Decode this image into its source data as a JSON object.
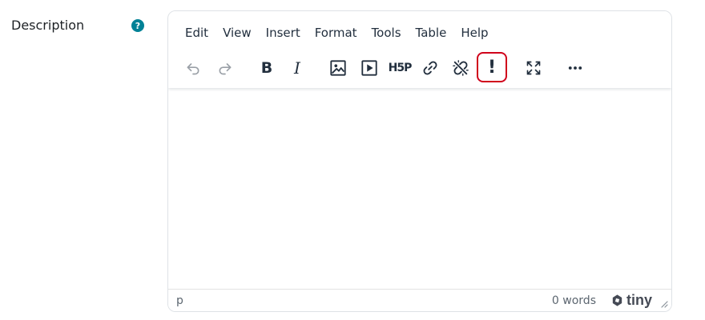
{
  "field": {
    "label": "Description",
    "help_symbol": "?"
  },
  "menubar": [
    "Edit",
    "View",
    "Insert",
    "Format",
    "Tools",
    "Table",
    "Help"
  ],
  "toolbar": {
    "undo": "undo-icon",
    "redo": "redo-icon",
    "bold": "B",
    "italic": "I",
    "image": "image-icon",
    "media": "media-icon",
    "h5p": "H5P",
    "link": "link-icon",
    "unlink": "unlink-icon",
    "highlight": "!",
    "fullscreen": "fullscreen-icon",
    "more": "more-icon",
    "highlight_color": "#d0021b"
  },
  "statusbar": {
    "path": "p",
    "wordcount": "0 words",
    "brand": "tiny"
  },
  "colors": {
    "help_badge": "#008196",
    "toolbar_icon": "#222f3e"
  }
}
